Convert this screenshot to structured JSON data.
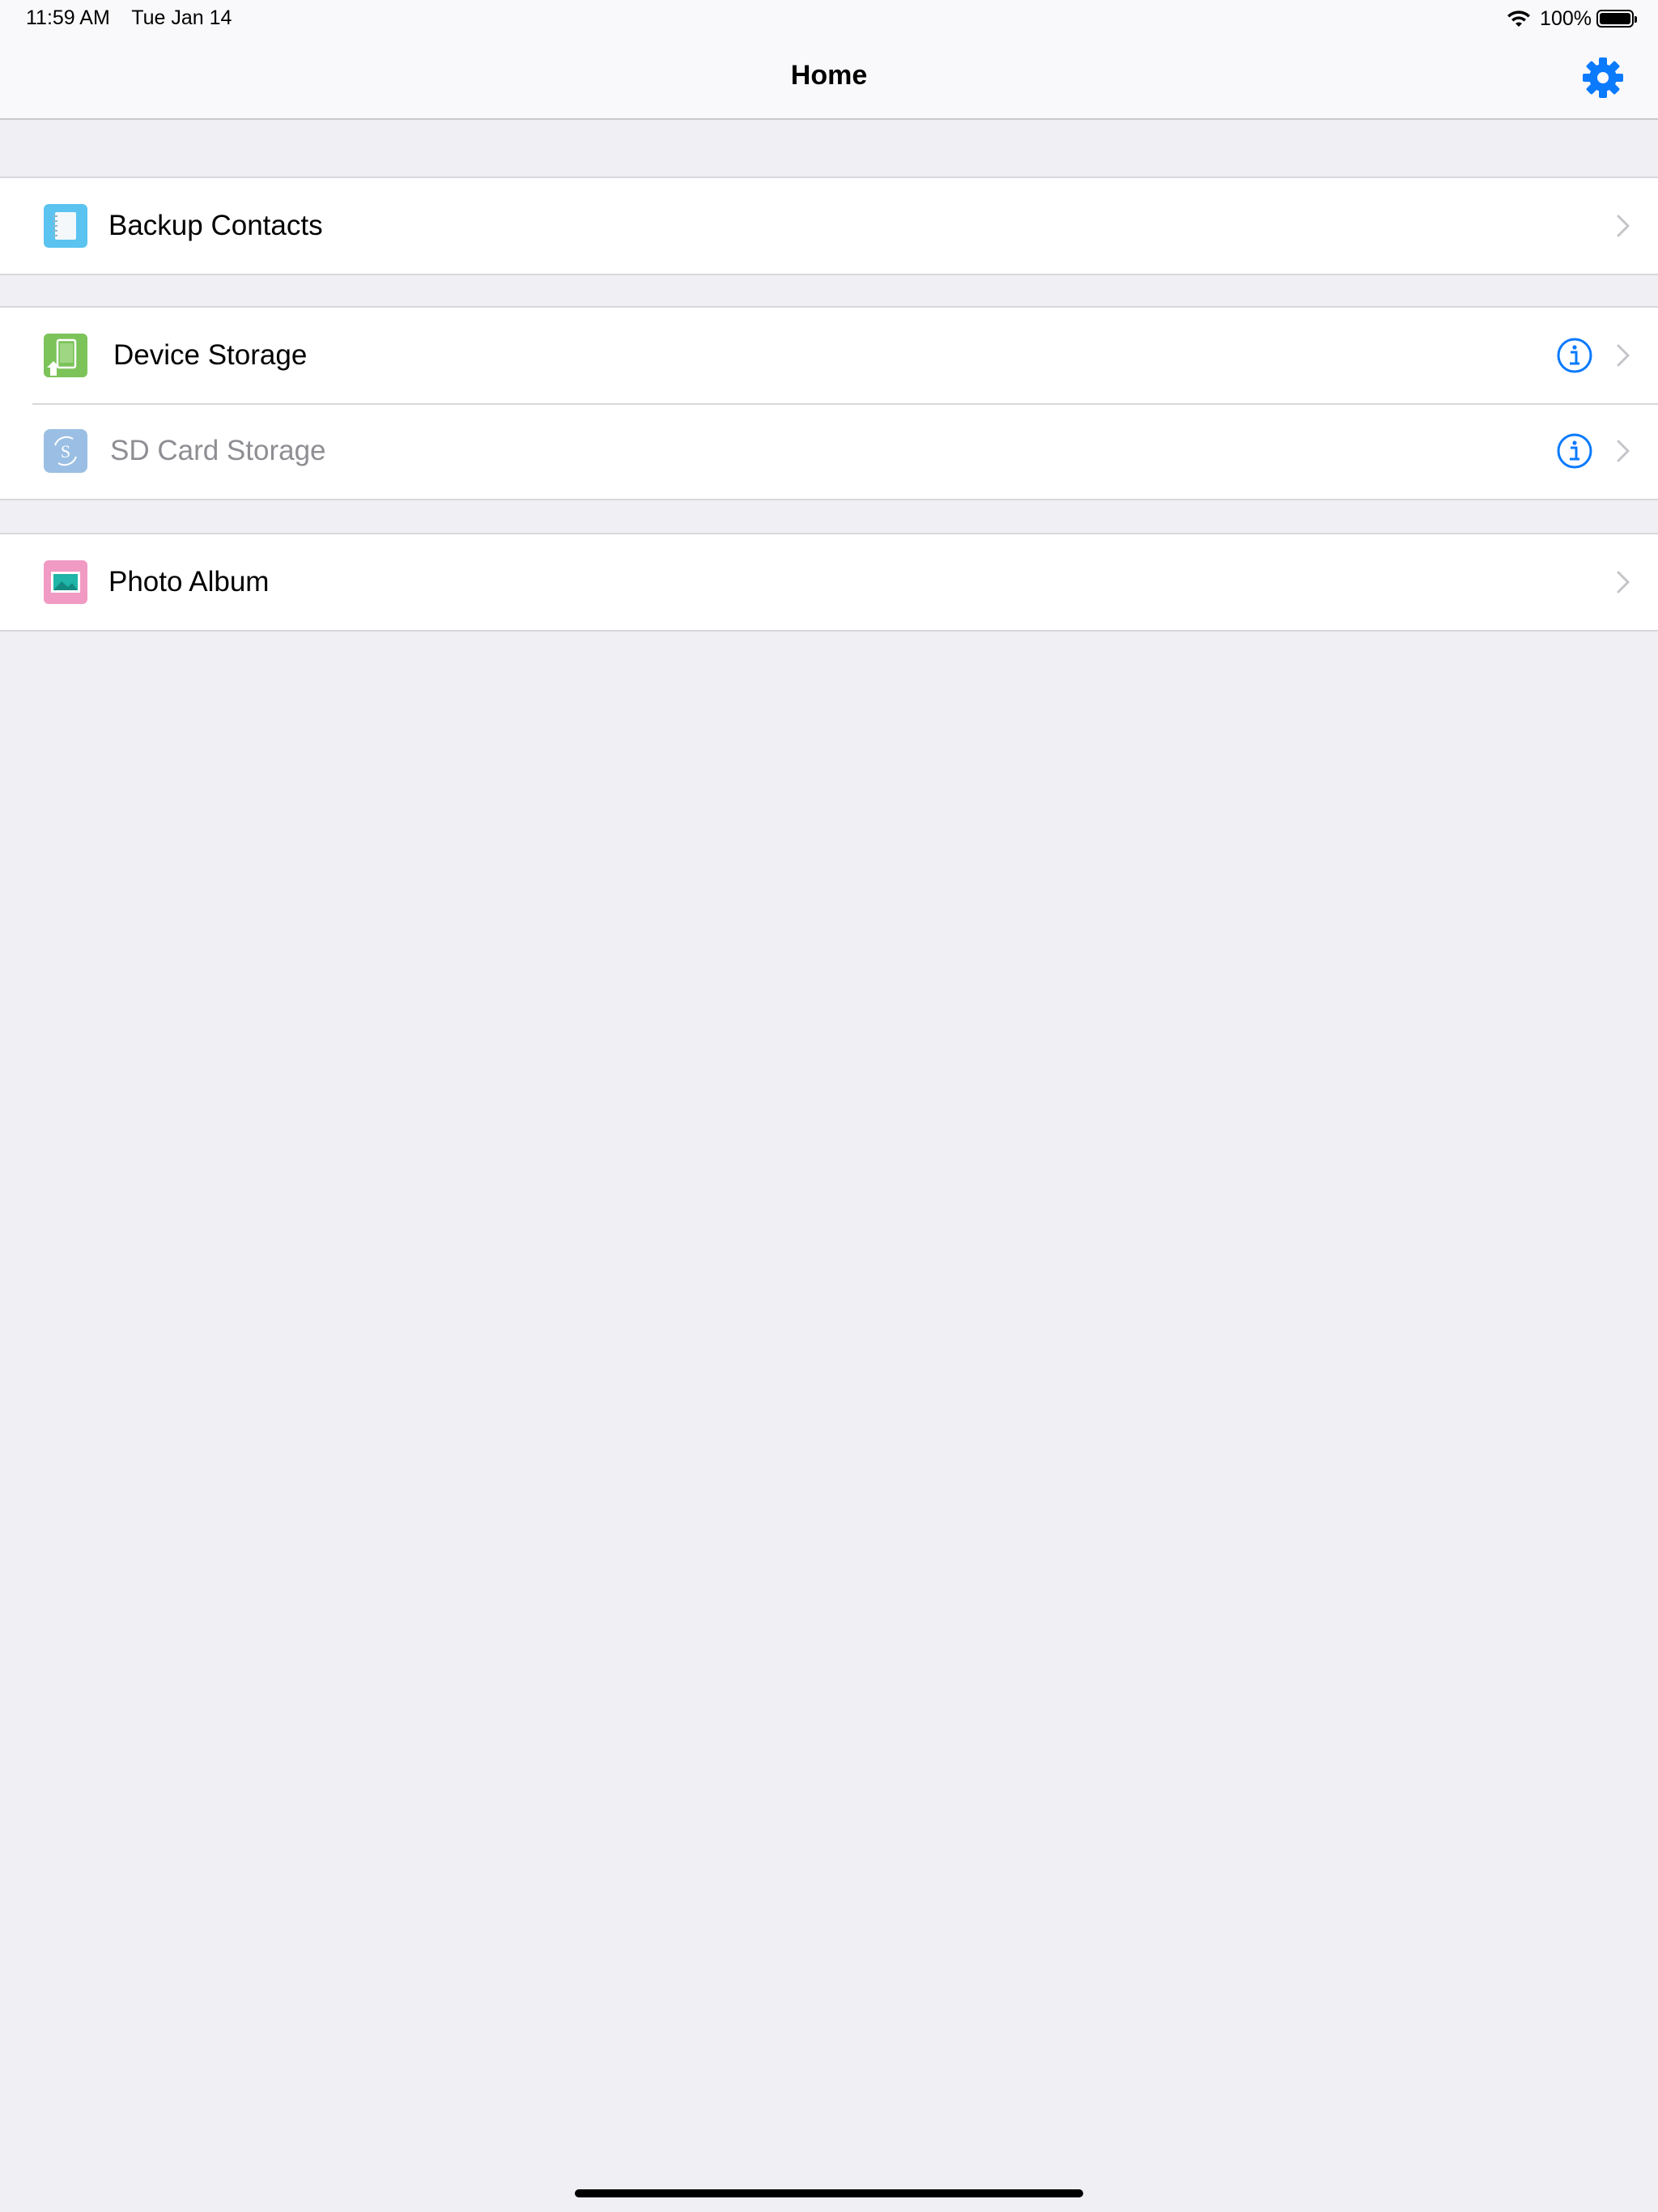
{
  "status_bar": {
    "time": "11:59 AM",
    "date": "Tue Jan 14",
    "battery": "100%",
    "battery_level": 1.0
  },
  "nav": {
    "title": "Home",
    "accent_color": "#0a7aff"
  },
  "groups": [
    {
      "rows": [
        {
          "label": "Backup Contacts",
          "icon": "contacts-book-icon",
          "icon_color": "#5ac3f0",
          "info": false,
          "enabled": true
        }
      ]
    },
    {
      "rows": [
        {
          "label": "Device Storage",
          "icon": "device-storage-icon",
          "icon_color": "#7cc35a",
          "info": true,
          "enabled": true
        },
        {
          "label": "SD Card Storage",
          "icon": "sd-card-icon",
          "icon_color": "#9bbfe4",
          "info": true,
          "enabled": false
        }
      ]
    },
    {
      "rows": [
        {
          "label": "Photo Album",
          "icon": "photo-album-icon",
          "icon_color": "#f19ac4",
          "info": false,
          "enabled": true
        }
      ]
    }
  ]
}
